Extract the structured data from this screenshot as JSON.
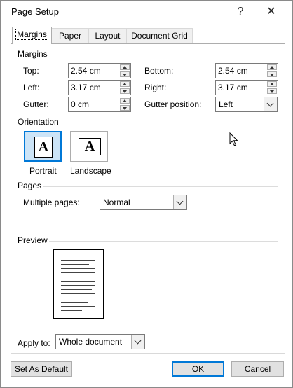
{
  "window": {
    "title": "Page Setup",
    "help_label": "?",
    "close_label": "✕"
  },
  "tabs": [
    "Margins",
    "Paper",
    "Layout",
    "Document Grid"
  ],
  "margins": {
    "group_label": "Margins",
    "top": {
      "label": "Top:",
      "value": "2.54 cm"
    },
    "bottom": {
      "label": "Bottom:",
      "value": "2.54 cm"
    },
    "left": {
      "label": "Left:",
      "value": "3.17 cm"
    },
    "right": {
      "label": "Right:",
      "value": "3.17 cm"
    },
    "gutter": {
      "label": "Gutter:",
      "value": "0 cm"
    },
    "gutter_position": {
      "label": "Gutter position:",
      "value": "Left"
    }
  },
  "orientation": {
    "group_label": "Orientation",
    "portrait_label": "Portrait",
    "landscape_label": "Landscape",
    "icon_glyph": "A",
    "selected": "Portrait"
  },
  "pages": {
    "group_label": "Pages",
    "multiple_pages_label": "Multiple pages:",
    "multiple_pages_value": "Normal"
  },
  "preview": {
    "group_label": "Preview"
  },
  "apply": {
    "label": "Apply to:",
    "value": "Whole document"
  },
  "buttons": {
    "set_default": "Set As Default",
    "ok": "OK",
    "cancel": "Cancel"
  },
  "colors": {
    "accent": "#0078d7",
    "selected_fill": "#cce4f7",
    "button_face": "#e1e1e1"
  }
}
